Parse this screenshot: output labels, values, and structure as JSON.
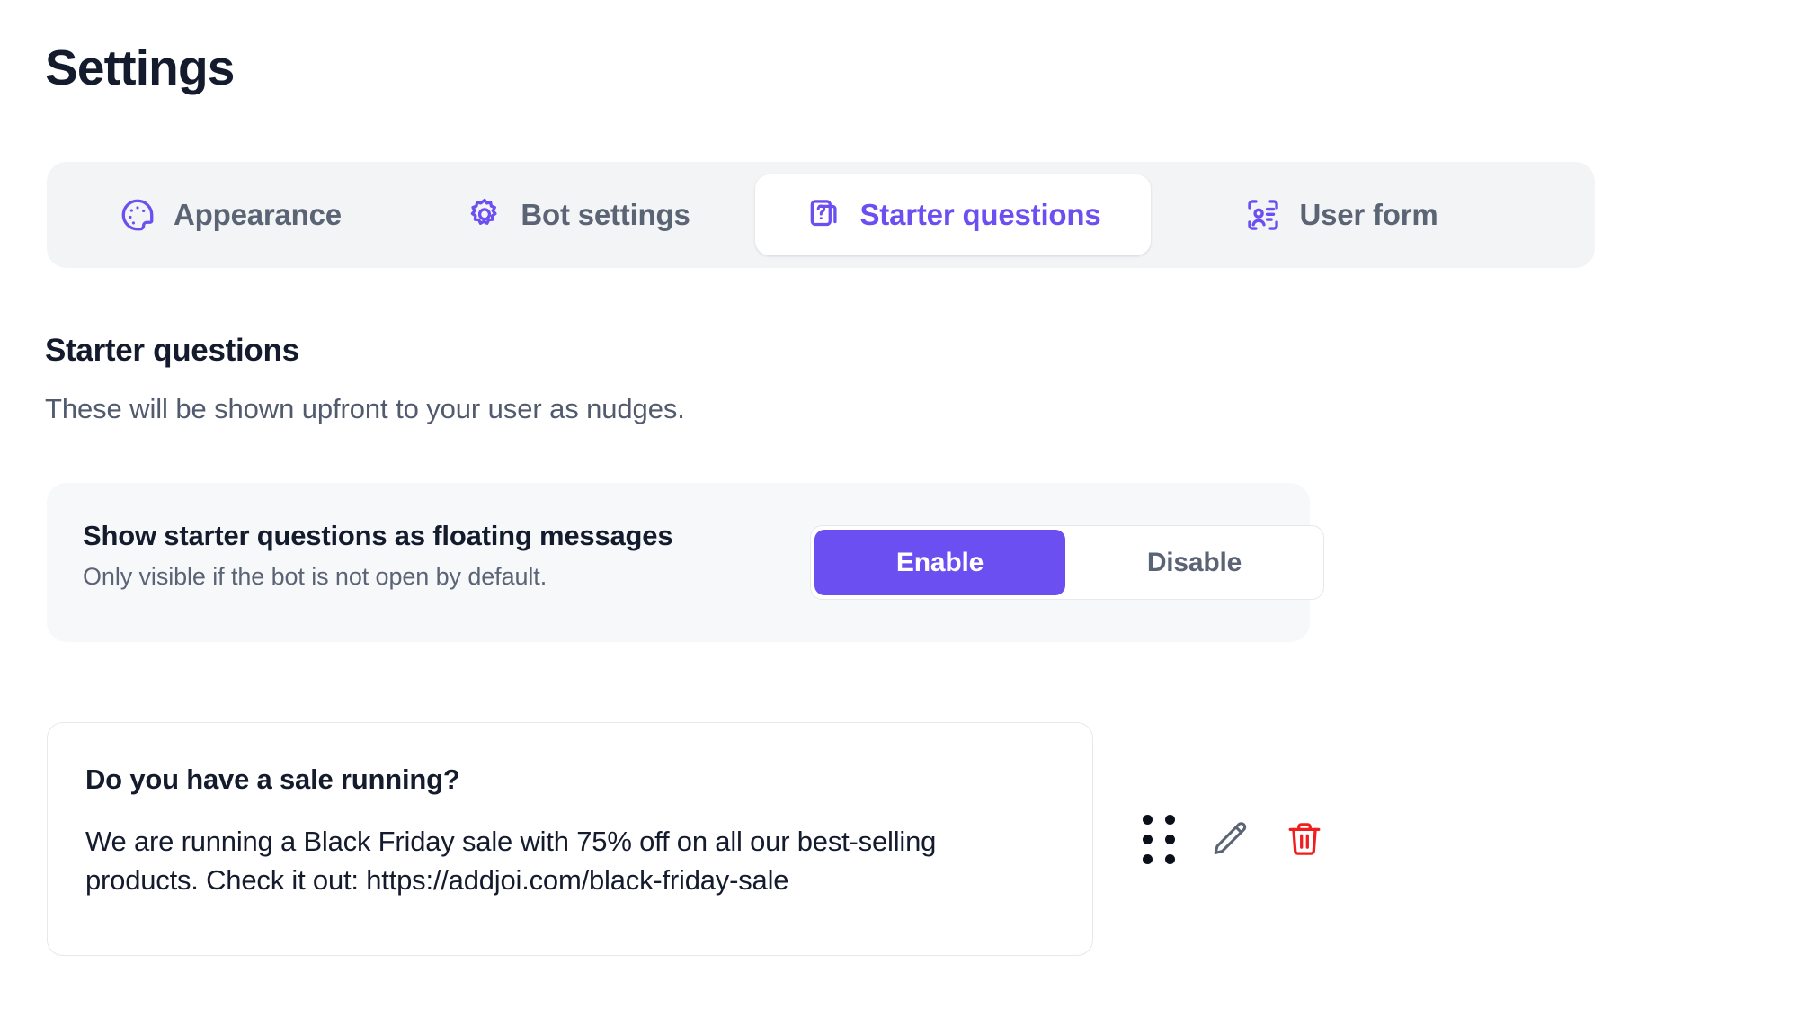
{
  "page": {
    "title": "Settings"
  },
  "tabs": [
    {
      "id": "appearance",
      "label": "Appearance",
      "icon": "palette-icon",
      "active": false
    },
    {
      "id": "bot-settings",
      "label": "Bot settings",
      "icon": "gear-icon",
      "active": false
    },
    {
      "id": "starter-questions",
      "label": "Starter questions",
      "icon": "question-cards-icon",
      "active": true
    },
    {
      "id": "user-form",
      "label": "User form",
      "icon": "user-card-icon",
      "active": false
    }
  ],
  "section": {
    "heading": "Starter questions",
    "description": "These will be shown upfront to your user as nudges."
  },
  "floating_setting": {
    "title": "Show starter questions as floating messages",
    "subtitle": "Only visible if the bot is not open by default.",
    "enable_label": "Enable",
    "disable_label": "Disable",
    "selected": "Enable"
  },
  "questions": [
    {
      "title": "Do you have a sale running?",
      "body": "We are running a Black Friday sale with 75% off on all our best-selling products. Check it out: https://addjoi.com/black-friday-sale",
      "actions": {
        "drag": "drag-handle-icon",
        "edit": "pencil-icon",
        "delete": "trash-icon"
      }
    }
  ],
  "colors": {
    "accent": "#6c4ff0",
    "danger": "#f01f1f",
    "title": "#141b2d",
    "muted": "#5b6475",
    "tabbar_bg": "#f3f4f6",
    "card_bg": "#f7f8fa",
    "border": "#e6e8ec"
  }
}
